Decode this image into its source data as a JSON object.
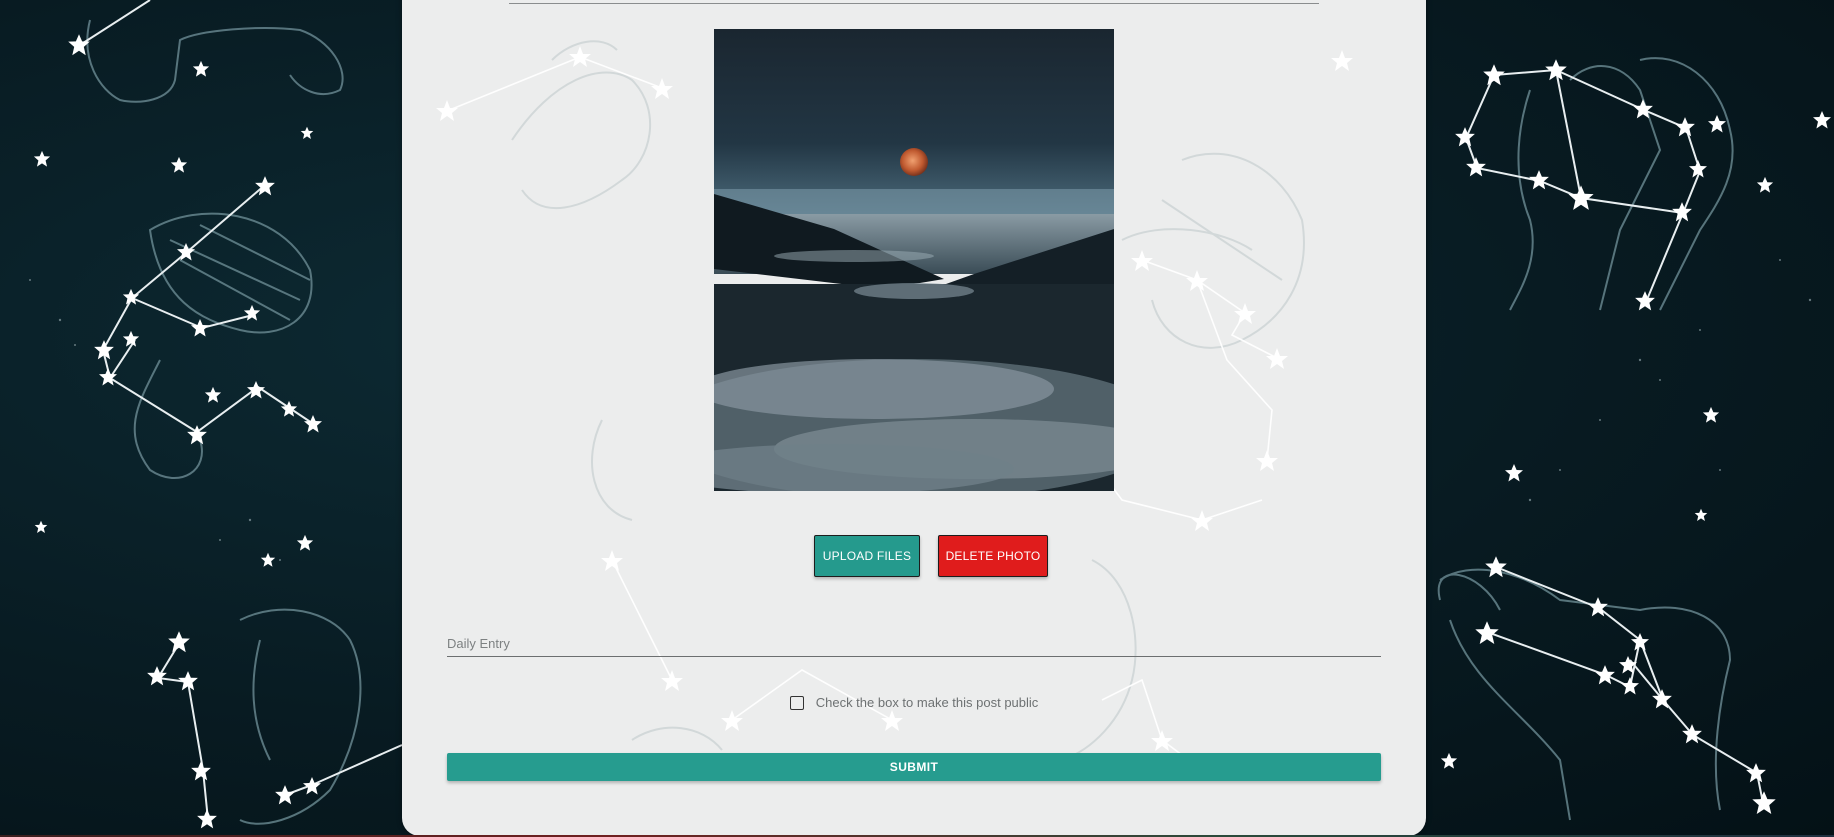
{
  "colors": {
    "background": "#081b22",
    "panel": "#eceded",
    "upload_button": "#259a8d",
    "delete_button": "#e01c1c",
    "submit_button": "#269c8f"
  },
  "photo": {
    "description_icon": "moon-over-clouds-photo"
  },
  "buttons": {
    "upload_label": "UPLOAD FILES",
    "delete_label": "DELETE PHOTO"
  },
  "entry": {
    "placeholder": "Daily Entry",
    "value": ""
  },
  "public_option": {
    "label": "Check the box to make this post public",
    "checked": false
  },
  "submit": {
    "label": "SUBMIT"
  }
}
